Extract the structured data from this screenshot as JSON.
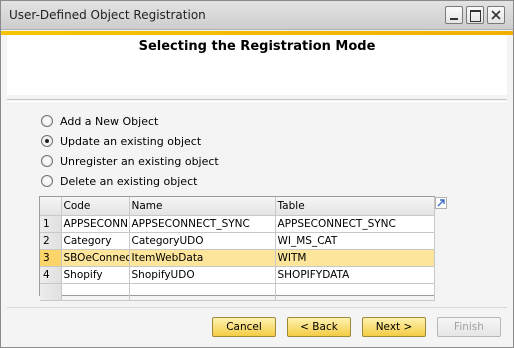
{
  "window": {
    "title": "User-Defined Object Registration",
    "accent_color": "#f4c400"
  },
  "header": {
    "title": "Selecting the Registration Mode"
  },
  "modes": [
    {
      "label": "Add a New Object",
      "checked": false
    },
    {
      "label": "Update an existing object",
      "checked": true
    },
    {
      "label": "Unregister an existing object",
      "checked": false
    },
    {
      "label": "Delete an existing object",
      "checked": false
    }
  ],
  "grid": {
    "columns": [
      "#",
      "Code",
      "Name",
      "Table"
    ],
    "rows": [
      {
        "num": "1",
        "code": "APPSECONNECT",
        "name": "APPSECONNECT_SYNC",
        "table": "APPSECONNECT_SYNC",
        "selected": false
      },
      {
        "num": "2",
        "code": "Category",
        "name": "CategoryUDO",
        "table": "WI_MS_CAT",
        "selected": false
      },
      {
        "num": "3",
        "code": "SBOeConnect_",
        "name": "ItemWebData",
        "table": "WITM",
        "selected": true
      },
      {
        "num": "4",
        "code": "Shopify",
        "name": "ShopifyUDO",
        "table": "SHOPIFYDATA",
        "selected": false
      },
      {
        "num": "",
        "code": "",
        "name": "",
        "table": "",
        "selected": false
      }
    ],
    "expand_icon": "expand-arrow-icon"
  },
  "buttons": {
    "cancel": "Cancel",
    "back": "< Back",
    "next": "Next >",
    "finish": "Finish"
  }
}
